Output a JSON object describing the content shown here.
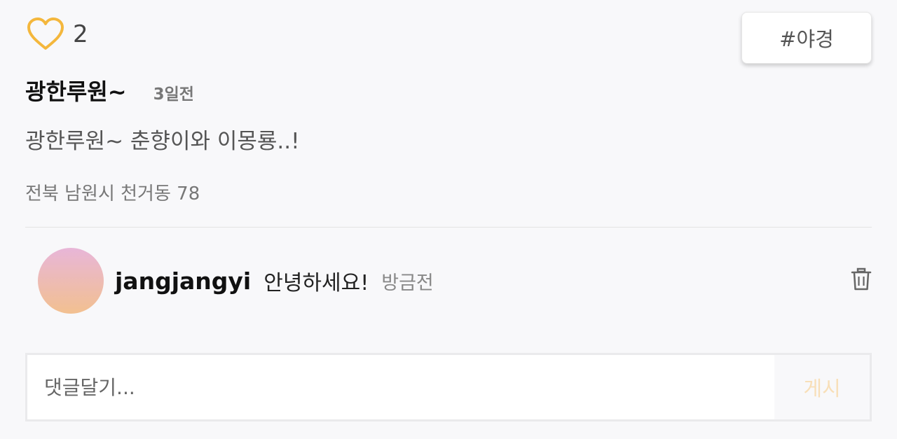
{
  "post": {
    "like_icon": "heart-outline-icon",
    "like_count": "2",
    "tag": "#야경",
    "title": "광한루원~",
    "time": "3일전",
    "body": "광한루원~ 춘향이와 이몽룡..!",
    "location": "전북 남원시 천거동 78"
  },
  "comments": [
    {
      "user": "jangjangyi",
      "text": "안녕하세요!",
      "time": "방금전",
      "delete_icon": "trash-icon"
    }
  ],
  "comment_form": {
    "placeholder": "댓글달기...",
    "submit_label": "게시"
  },
  "colors": {
    "heart": "#f4b73c",
    "submit_disabled": "#f8dfb8",
    "avatar_gradient_top": "#e8b6d8",
    "avatar_gradient_bottom": "#f2c090"
  }
}
